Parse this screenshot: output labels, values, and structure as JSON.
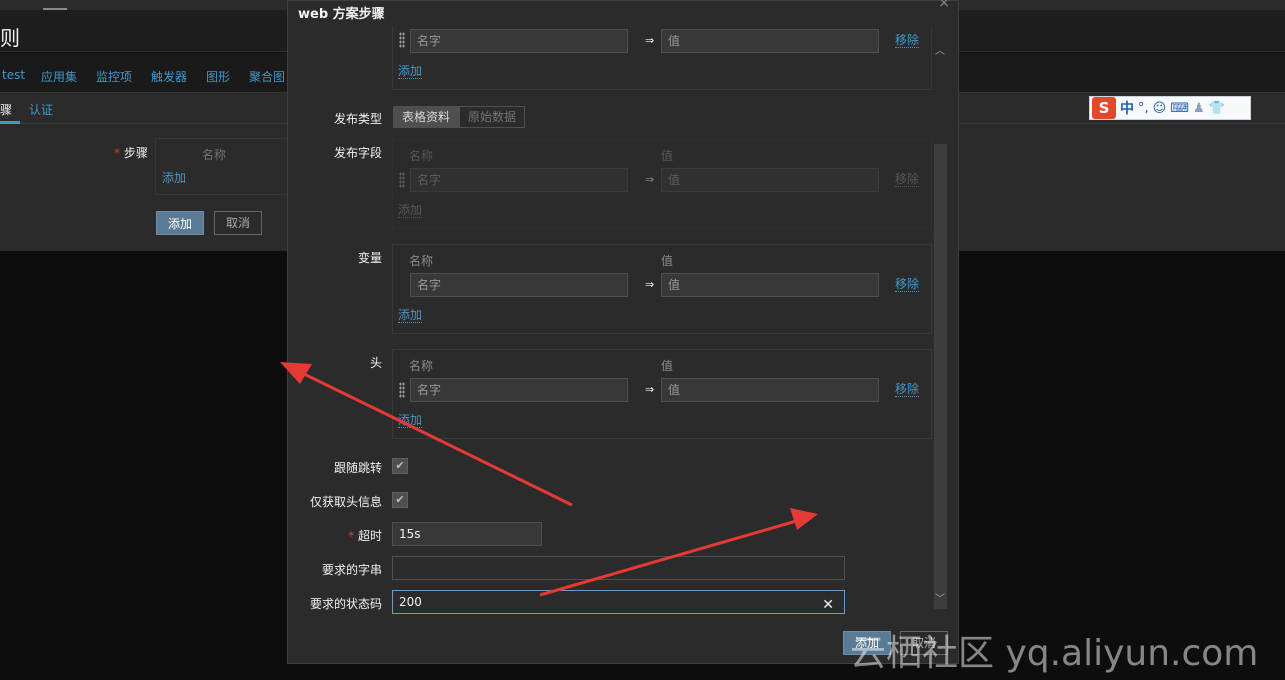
{
  "background": {
    "title": "则",
    "breadcrumbs": [
      "test",
      "应用集",
      "监控项",
      "触发器",
      "图形",
      "聚合图"
    ],
    "tabs": [
      "骤",
      "认证"
    ],
    "form": {
      "steps_label": "步骤",
      "steps_column": "名称",
      "steps_add": "添加",
      "add_button": "添加",
      "cancel_button": "取消"
    }
  },
  "ime_toolbar": {
    "logo": "S",
    "lang": "中"
  },
  "dialog": {
    "title": "web 方案步骤",
    "query_row": {
      "name_placeholder": "名字",
      "value_placeholder": "值",
      "remove": "移除",
      "add": "添加"
    },
    "post_type": {
      "label": "发布类型",
      "options": [
        "表格资料",
        "原始数据"
      ],
      "selected": "表格资料"
    },
    "post_fields": {
      "label": "发布字段",
      "col_name": "名称",
      "col_value": "值",
      "name_placeholder": "名字",
      "value_placeholder": "值",
      "remove": "移除",
      "add": "添加"
    },
    "variables": {
      "label": "变量",
      "col_name": "名称",
      "col_value": "值",
      "name_placeholder": "名字",
      "value_placeholder": "值",
      "remove": "移除",
      "add": "添加"
    },
    "headers": {
      "label": "头",
      "col_name": "名称",
      "col_value": "值",
      "name_placeholder": "名字",
      "value_placeholder": "值",
      "remove": "移除",
      "add": "添加"
    },
    "follow_redirects": {
      "label": "跟随跳转",
      "checked": true
    },
    "retrieve_headers_only": {
      "label": "仅获取头信息",
      "checked": true
    },
    "timeout": {
      "label": "超时",
      "value": "15s"
    },
    "required_string": {
      "label": "要求的字串",
      "value": ""
    },
    "required_status": {
      "label": "要求的状态码",
      "value": "200"
    },
    "add_button": "添加",
    "cancel_button": "取消"
  },
  "watermark": "云栖社区 yq.aliyun.com",
  "colors": {
    "annotation_arrow": "#e53935",
    "link": "#4796c4",
    "primary_button": "#5b7a96"
  }
}
